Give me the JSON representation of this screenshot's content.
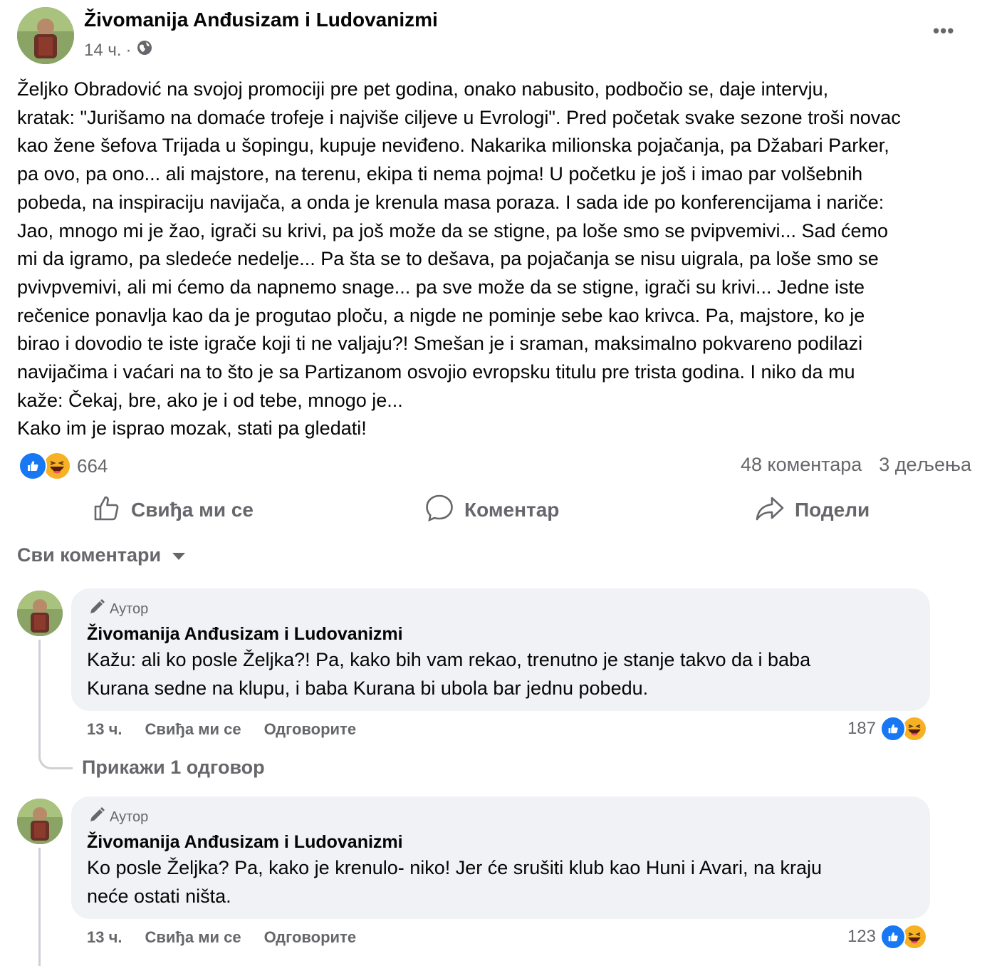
{
  "post": {
    "author": "Živomanija Anđusizam i Ludovanizmi",
    "time": "14 ч.",
    "separator": "·",
    "icons": {
      "audience": "globe-icon",
      "more": "more-horizontal-icon"
    },
    "more_label": "•••",
    "text_lines": [
      "Željko Obradović na svojoj promociji pre pet godina, onako nabusito, podbočio se, daje intervju,",
      "kratak: \"Jurišamo na domaće trofeje i najviše ciljeve u Evrologi\". Pred početak svake sezone troši novac",
      "kao žene šefova Trijada u šopingu, kupuje neviđeno. Nakarika milionska pojačanja, pa Džabari Parker,",
      "pa ovo, pa ono... ali majstore, na terenu, ekipa ti nema pojma! U početku je još i imao par volšebnih",
      "pobeda, na inspiraciju navijača, a onda je krenula masa poraza. I sada ide po konferencijama i nariče:",
      "Jao, mnogo mi je žao, igrači su krivi, pa još može da se stigne, pa loše smo se pvipvemivi... Sad ćemo",
      "mi da igramo, pa sledeće nedelje... Pa šta se to dešava, pa pojačanja se nisu uigrala, pa loše smo se",
      "pvivpvemivi, ali mi ćemo da napnemo snage...  pa sve može da se stigne, igrači su krivi... Jedne iste",
      "rečenice ponavlja kao da je progutao ploču, a nigde ne pominje sebe kao krivca. Pa, majstore, ko je",
      "birao i dovodio te iste igrače koji ti ne valjaju?! Smešan je i sraman, maksimalno pokvareno podilazi",
      "navijačima i vaćari na to što je sa Partizanom osvojio evropsku titulu pre trista godina.  I niko da mu",
      "kaže: Čekaj, bre, ako je i od tebe, mnogo je...",
      "Kako im je isprao mozak, stati pa gledati!"
    ],
    "reaction_count": "664",
    "comments_count": "48 коментара",
    "shares_count": "3 дељења",
    "reaction_types": [
      "like",
      "haha"
    ]
  },
  "actions": {
    "like": "Свиђа ми се",
    "comment": "Коментар",
    "share": "Подели"
  },
  "comments_filter": {
    "label": "Сви коментари",
    "icon": "caret-down-icon"
  },
  "comments": [
    {
      "badge": "Аутор",
      "author": "Živomanija Anđusizam i Ludovanizmi",
      "text_lines": [
        "Kažu: ali ko posle Željka?! Pa, kako bih vam rekao, trenutno je stanje takvo da i baba",
        "Kurana sedne na klupu, i baba Kurana bi ubola bar jednu pobedu."
      ],
      "time": "13 ч.",
      "like_label": "Свиђа ми се",
      "reply_label": "Одговорите",
      "reaction_count": "187",
      "replies_label": "Прикажи 1 одговор"
    },
    {
      "badge": "Аутор",
      "author": "Živomanija Anđusizam i Ludovanizmi",
      "text_lines": [
        "Ko posle Željka? Pa, kako je krenulo- niko! Jer će srušiti klub kao Huni i Avari, na kraju",
        "neće ostati ništa."
      ],
      "time": "13 ч.",
      "like_label": "Свиђа ми се",
      "reply_label": "Одговорите",
      "reaction_count": "123"
    }
  ],
  "colors": {
    "text_primary": "#050505",
    "text_secondary": "#65676b",
    "bubble_bg": "#f0f2f5",
    "like_blue": "#1877f2",
    "haha_yellow": "#f7b125"
  }
}
